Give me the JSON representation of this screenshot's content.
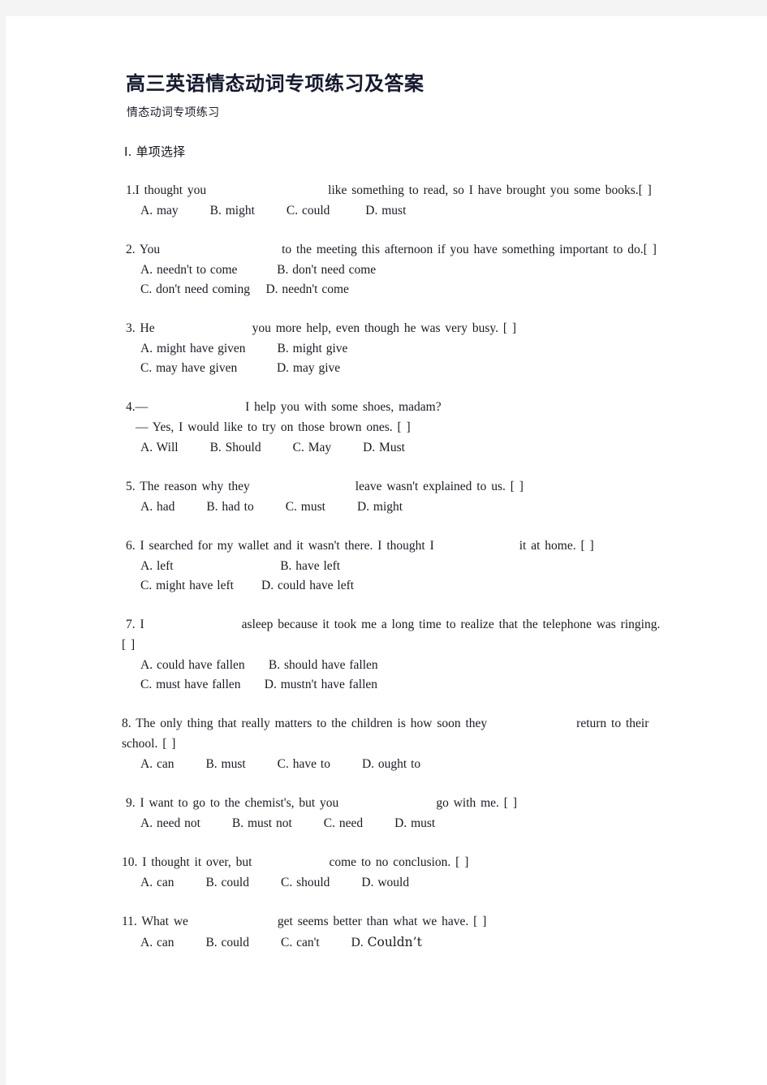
{
  "document": {
    "title": "高三英语情态动词专项练习及答案",
    "subtitle": "情态动词专项练习",
    "section_heading": "Ⅰ. 单项选择",
    "title_color": "#161a2e",
    "page_background": "#ffffff",
    "canvas_background": "#f4f4f4"
  },
  "questions": [
    {
      "number": "1.",
      "stem_before": "1.I thought you",
      "stem_after": "like something to read, so I have brought you some books.[    ]",
      "blank_width": 150,
      "option_lines": [
        "A. may        B. might        C. could         D. must"
      ]
    },
    {
      "number": "2.",
      "stem_before": "2. You",
      "stem_after": "to the meeting this afternoon if you have something important to do.[    ]",
      "blank_width": 150,
      "option_lines": [
        "A. needn't to come          B. don't need come",
        "C. don't need coming    D. needn't come"
      ]
    },
    {
      "number": "3.",
      "stem_before": "3. He",
      "stem_after": "you more help, even though he was very busy. [    ]",
      "blank_width": 120,
      "option_lines": [
        "A. might have given        B. might give",
        "C. may have given          D. may give"
      ]
    },
    {
      "number": "4.",
      "stem_before": "4.—",
      "stem_after": "I help you with some shoes, madam?",
      "blank_width": 120,
      "extra_line": "— Yes, I would like to try on those brown ones. [    ]",
      "option_lines": [
        "A. Will        B. Should        C. May        D. Must"
      ]
    },
    {
      "number": "5.",
      "stem_before": "5. The reason why they",
      "stem_after": "leave wasn't explained to us. [    ]",
      "blank_width": 130,
      "option_lines": [
        "A. had        B. had to        C. must        D. might"
      ]
    },
    {
      "number": "6.",
      "stem_before": "6. I searched for my wallet and it wasn't there. I thought I",
      "stem_after": "it at home. [    ]",
      "blank_width": 105,
      "option_lines": [
        "A. left                           B. have left",
        "C. might have left       D. could have left"
      ]
    },
    {
      "number": "7.",
      "stem_before": "7. I",
      "stem_after": "asleep because it took me a long time to realize that the telephone was ringing.",
      "blank_width": 120,
      "wrap_line": "[   ]",
      "option_lines": [
        "A. could have fallen      B. should have fallen",
        "C. must have fallen      D. mustn't have fallen"
      ]
    },
    {
      "number": "8.",
      "stem_before": "8. The only thing that really matters to the children is how soon they",
      "stem_after": "return to their",
      "blank_width": 110,
      "wrap_line": "school. [   ]",
      "option_lines": [
        "A. can        B. must        C. have to        D. ought to"
      ]
    },
    {
      "number": "9.",
      "stem_before": "9. I want to go to the chemist's, but you",
      "stem_after": "go with me.    [    ]",
      "blank_width": 120,
      "option_lines": [
        "A. need not        B. must not        C. need        D. must"
      ]
    },
    {
      "number": "10.",
      "stem_before": "10. I thought it over, but",
      "stem_after": "come to no conclusion. [    ]",
      "blank_width": 95,
      "option_lines": [
        "A. can        B. could        C. should        D. would"
      ]
    },
    {
      "number": "11.",
      "stem_before": "11. What we",
      "stem_after": "get seems better than what we have. [    ]",
      "blank_width": 110,
      "option_lines": [
        "A. can        B. could        C. can't        D. "
      ],
      "emphasized_option": "Couldn’t"
    }
  ]
}
